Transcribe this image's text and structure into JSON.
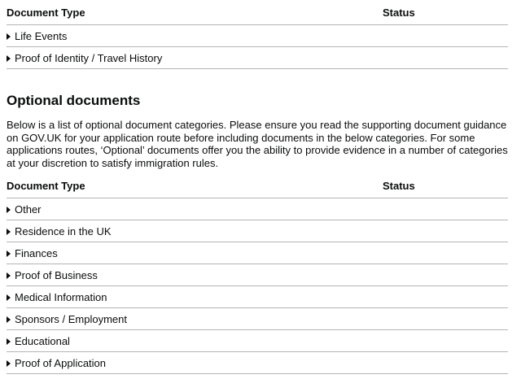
{
  "required_table": {
    "header_type": "Document Type",
    "header_status": "Status",
    "rows": [
      {
        "label": "Life Events"
      },
      {
        "label": "Proof of Identity / Travel History"
      }
    ]
  },
  "optional": {
    "title": "Optional documents",
    "intro": "Below is a list of optional document categories. Please ensure you read the supporting document guidance on GOV.UK for your application route before including documents in the below categories. For some applications routes, ‘Optional’ documents offer you the ability to provide evidence in a number of categories at your discretion to satisfy immigration rules.",
    "table": {
      "header_type": "Document Type",
      "header_status": "Status",
      "rows": [
        {
          "label": "Other"
        },
        {
          "label": "Residence in the UK"
        },
        {
          "label": "Finances"
        },
        {
          "label": "Proof of Business"
        },
        {
          "label": "Medical Information"
        },
        {
          "label": "Sponsors / Employment"
        },
        {
          "label": "Educational"
        },
        {
          "label": "Proof of Application"
        }
      ]
    }
  }
}
